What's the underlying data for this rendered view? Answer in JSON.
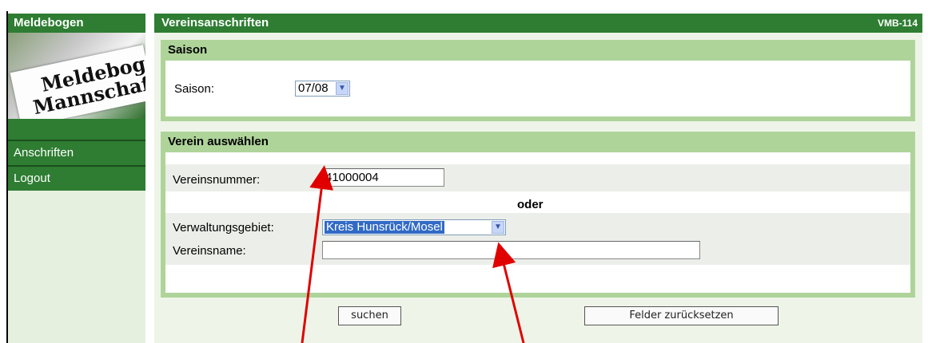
{
  "sidebar": {
    "title": "Meldebogen",
    "banner": {
      "line1": "Meldebogen",
      "line2": "Mannschaft:"
    },
    "items": [
      {
        "label": "Anschriften"
      },
      {
        "label": "Logout"
      }
    ]
  },
  "header": {
    "title": "Vereinsanschriften",
    "code": "VMB-114"
  },
  "season_panel": {
    "title": "Saison",
    "label": "Saison:",
    "selected": "07/08"
  },
  "club_panel": {
    "title": "Verein auswählen",
    "number_label": "Vereinsnummer:",
    "number_value": "41000004",
    "separator": "oder",
    "area_label": "Verwaltungsgebiet:",
    "area_selected": "Kreis Hunsrück/Mosel",
    "name_label": "Vereinsname:",
    "name_value": ""
  },
  "buttons": {
    "search": "suchen",
    "reset": "Felder zurücksetzen"
  },
  "colors": {
    "brand_green": "#2e7d32",
    "panel_green": "#afd49a",
    "selection_blue": "#316ac5",
    "annotation_red": "#e00000"
  }
}
